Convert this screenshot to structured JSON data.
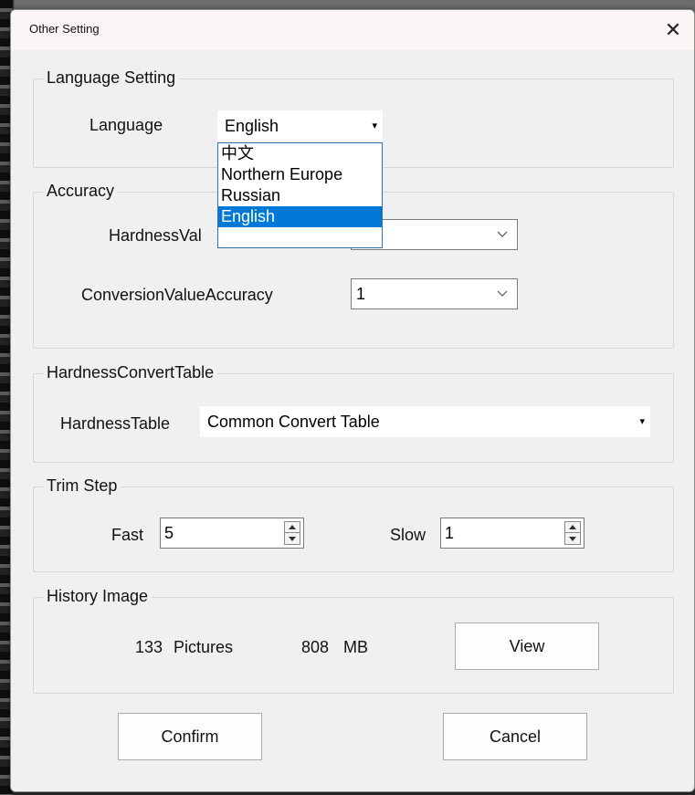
{
  "window": {
    "title": "Other Setting",
    "close_glyph": "✕"
  },
  "language_group": {
    "title": "Language Setting",
    "label": "Language",
    "selected": "English",
    "arrow": "▾",
    "options": [
      "中文",
      "Northern Europe",
      "Russian",
      "English"
    ],
    "highlighted_index": 3
  },
  "accuracy_group": {
    "title": "Accuracy",
    "hardness_label_visible": "HardnessVal",
    "conversion_label": "ConversionValueAccuracy",
    "conversion_value": "1"
  },
  "convert_table_group": {
    "title": "HardnessConvertTable",
    "label": "HardnessTable",
    "selected": "Common Convert Table",
    "arrow": "▾"
  },
  "trim_step_group": {
    "title": "Trim Step",
    "fast_label": "Fast",
    "fast_value": "5",
    "slow_label": "Slow",
    "slow_value": "1"
  },
  "history_group": {
    "title": "History Image",
    "picture_count": "133",
    "pictures_label": "Pictures",
    "size_value": "808",
    "size_unit": "MB",
    "view_button": "View"
  },
  "footer": {
    "confirm_label": "Confirm",
    "cancel_label": "Cancel"
  },
  "colors": {
    "selection": "#0078d7",
    "dropdown_border": "#2f6fb7",
    "dialog_bg": "#f0f0f0"
  },
  "icons": {
    "close": "close-icon",
    "combo_arrow": "chevron-down-icon",
    "spin_up": "spin-up-icon",
    "spin_down": "spin-down-icon"
  }
}
